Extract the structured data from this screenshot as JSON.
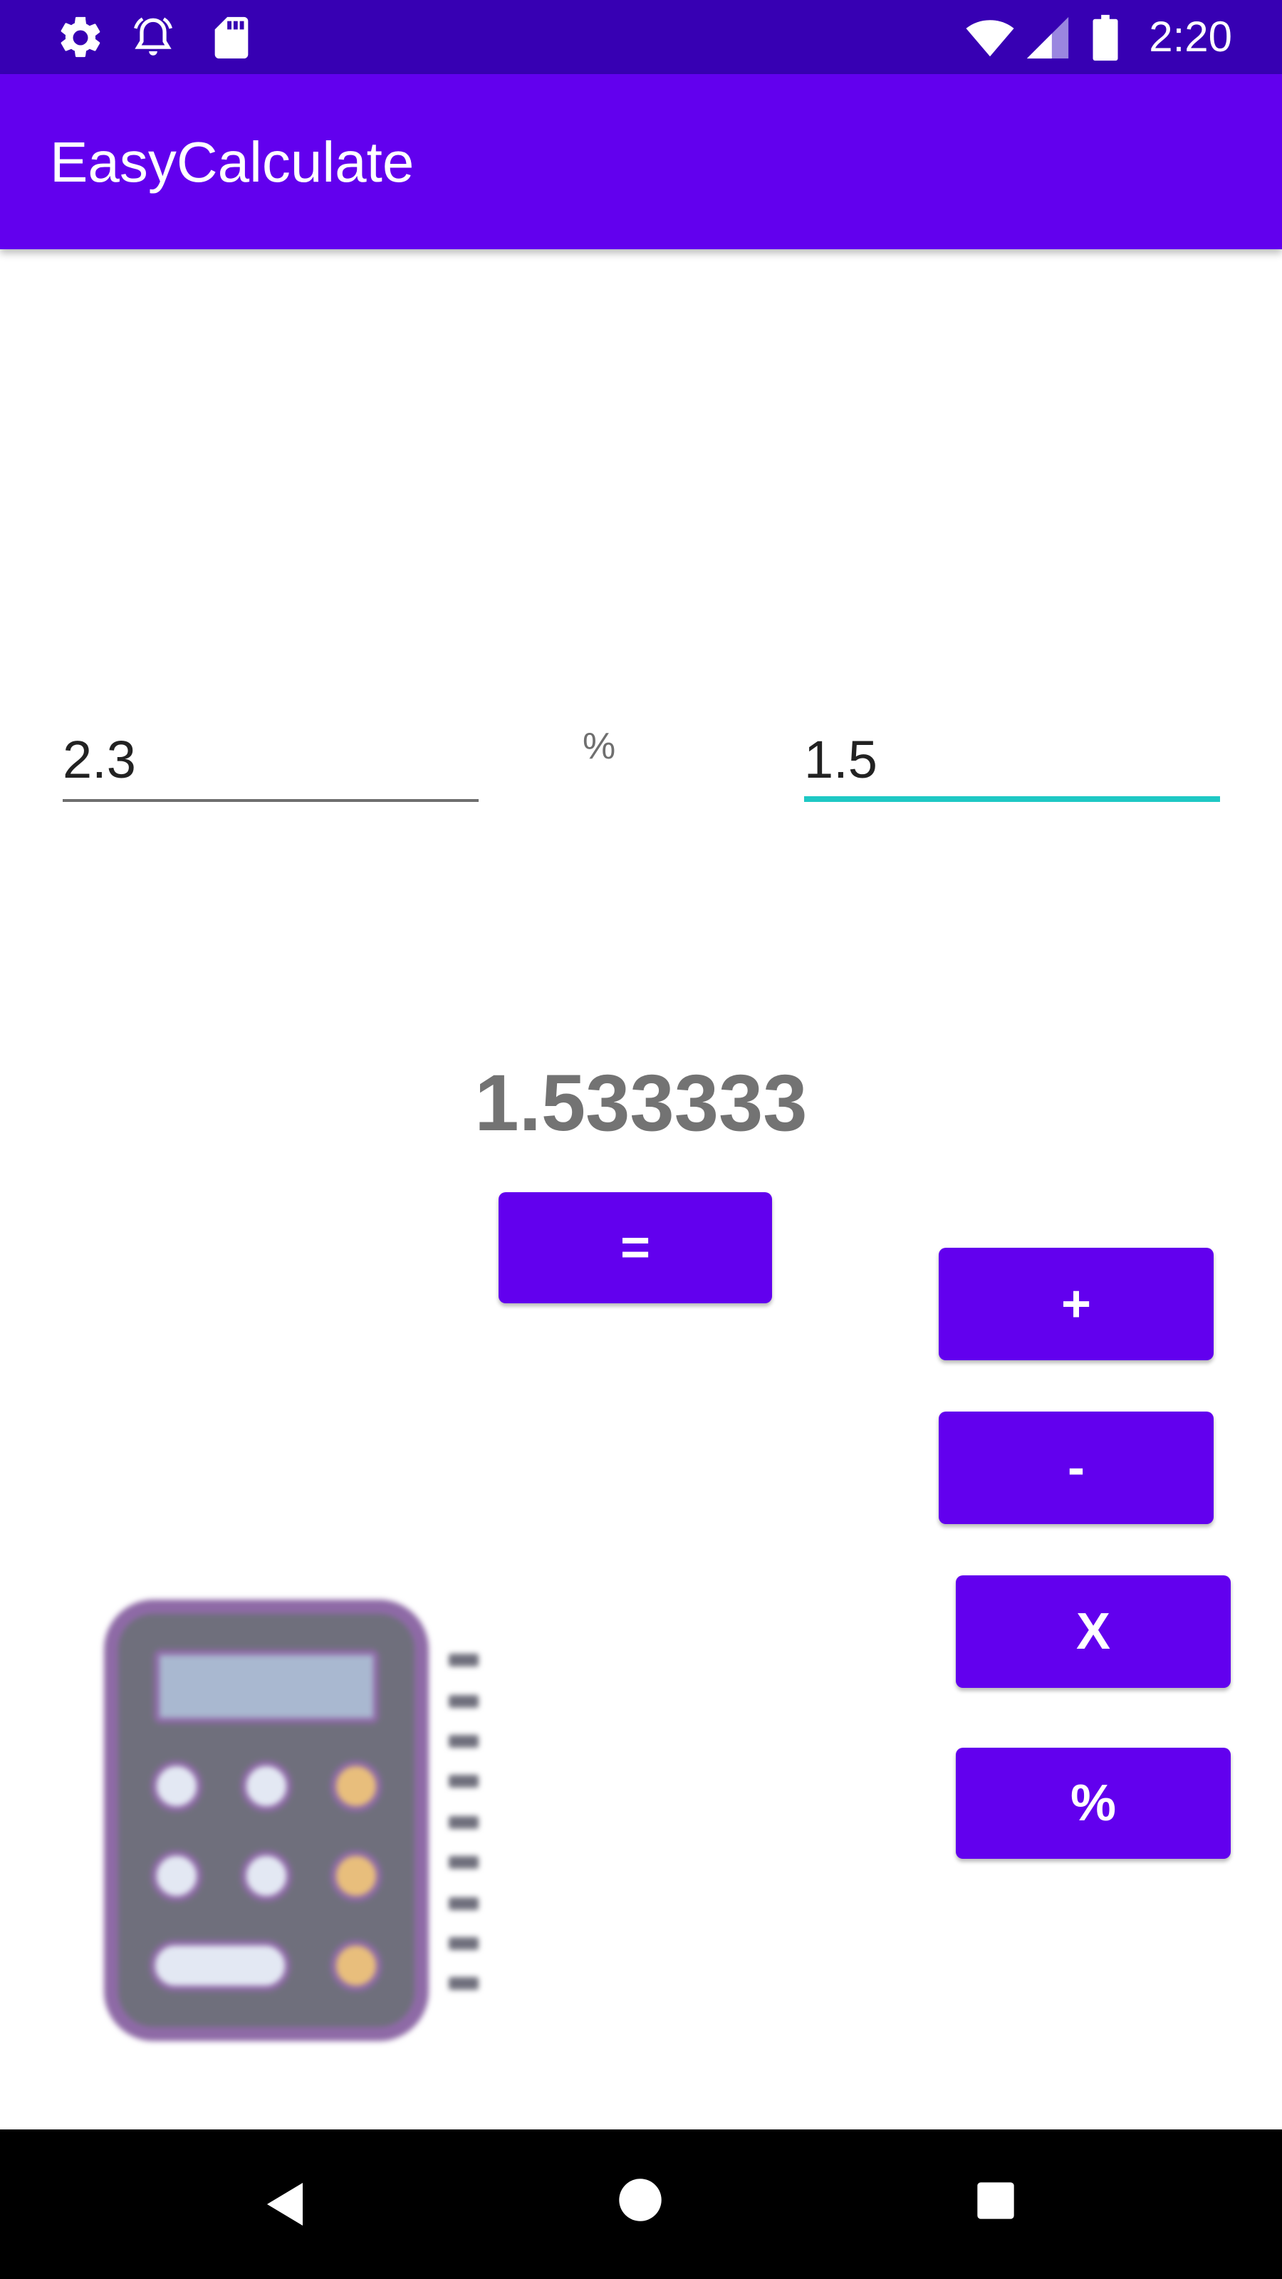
{
  "status_bar": {
    "time": "2:20",
    "left_icons": [
      "settings-icon",
      "alarm-icon",
      "sd-card-icon"
    ],
    "right_icons": [
      "wifi-icon",
      "cell-signal-icon",
      "battery-icon"
    ]
  },
  "app_bar": {
    "title": "EasyCalculate"
  },
  "calculator": {
    "first_operand": "2.3",
    "operator": "%",
    "second_operand": "1.5",
    "result": "1.5333333"
  },
  "buttons": {
    "equals": "=",
    "plus": "+",
    "minus": "-",
    "times": "X",
    "percent": "%"
  },
  "illustration": {
    "icon": "calculator-icon",
    "colors": {
      "body": "#6f6f7c",
      "border": "#8e6aa6",
      "display": "#a9b8d0",
      "key_light": "#e3e8f3",
      "key_accent": "#e8be7c"
    }
  },
  "nav_bar": {
    "icons": [
      "back-icon",
      "home-icon",
      "recents-icon"
    ]
  },
  "colors": {
    "status_bar": "#3700b3",
    "primary": "#6200ee",
    "focused_underline": "#1ec8c4",
    "result_text": "#737373"
  }
}
